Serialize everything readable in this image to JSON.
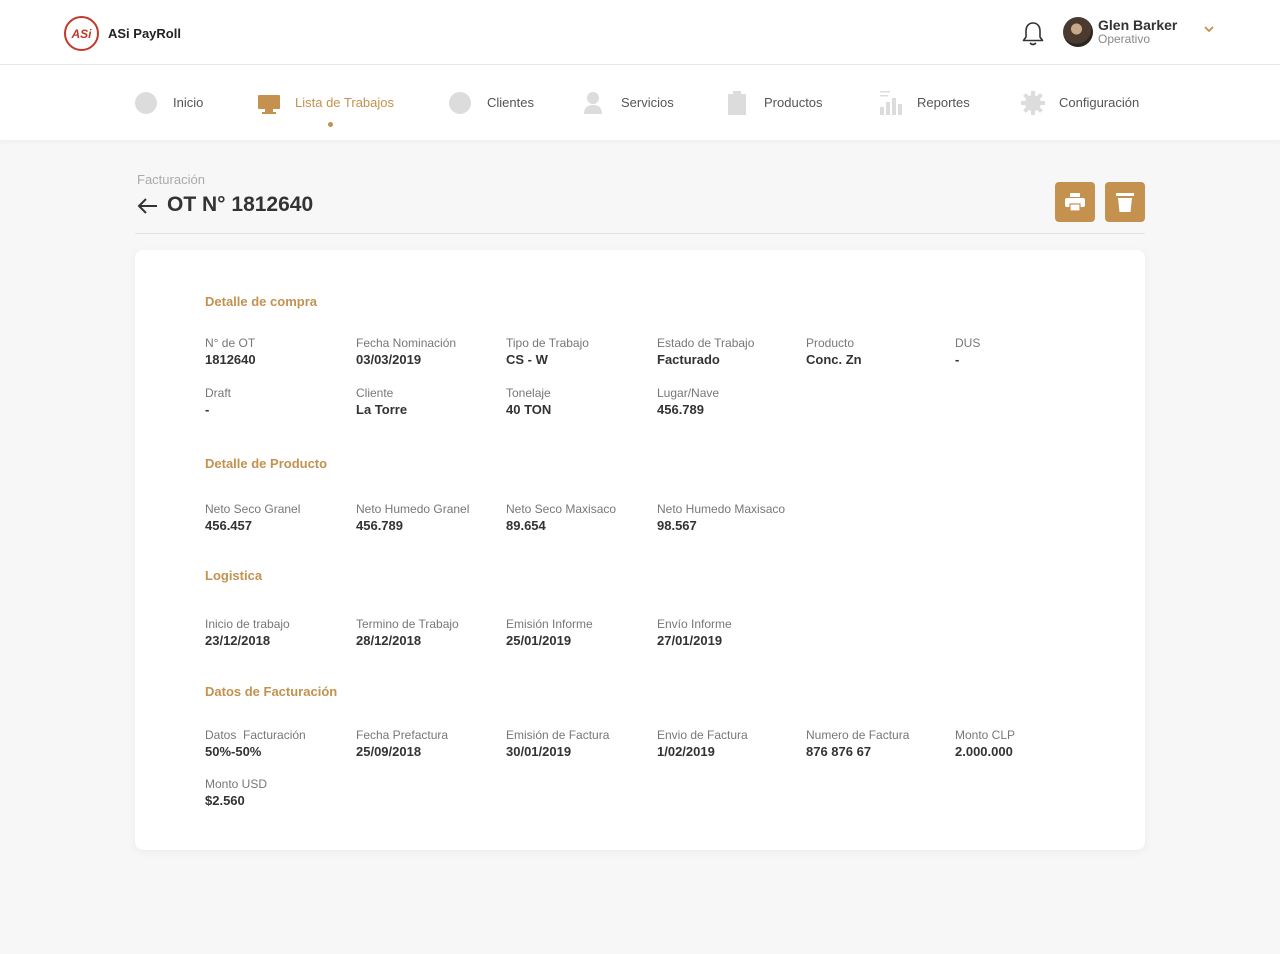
{
  "app": {
    "name": "ASi PayRoll",
    "logo_text": "ASi"
  },
  "user": {
    "name": "Glen Barker",
    "role": "Operativo"
  },
  "nav": {
    "items": [
      {
        "label": "Inicio",
        "icon": "home-icon"
      },
      {
        "label": "Lista de Trabajos",
        "icon": "monitor-icon",
        "active": true
      },
      {
        "label": "Clientes",
        "icon": "clients-icon"
      },
      {
        "label": "Servicios",
        "icon": "user-icon"
      },
      {
        "label": "Productos",
        "icon": "clipboard-icon"
      },
      {
        "label": "Reportes",
        "icon": "chart-icon"
      },
      {
        "label": "Configuración",
        "icon": "gear-icon"
      }
    ]
  },
  "colors": {
    "accent": "#c4914f",
    "logo": "#c0392b"
  },
  "header": {
    "breadcrumb": "Facturación",
    "title": "OT N° 1812640"
  },
  "sections": {
    "compra": {
      "title": "Detalle de compra",
      "fields": [
        {
          "label": "N° de OT",
          "value": "1812640"
        },
        {
          "label": "Fecha Nominación",
          "value": "03/03/2019"
        },
        {
          "label": "Tipo de Trabajo",
          "value": "CS - W"
        },
        {
          "label": "Estado de Trabajo",
          "value": "Facturado"
        },
        {
          "label": "Producto",
          "value": "Conc. Zn"
        },
        {
          "label": "DUS",
          "value": "-"
        },
        {
          "label": "Draft",
          "value": "-"
        },
        {
          "label": "Cliente",
          "value": "La Torre"
        },
        {
          "label": "Tonelaje",
          "value": "40 TON"
        },
        {
          "label": "Lugar/Nave",
          "value": "456.789"
        }
      ]
    },
    "producto": {
      "title": "Detalle de Producto",
      "fields": [
        {
          "label": "Neto Seco Granel",
          "value": "456.457"
        },
        {
          "label": "Neto Humedo Granel",
          "value": "456.789"
        },
        {
          "label": "Neto Seco Maxisaco",
          "value": "89.654"
        },
        {
          "label": "Neto Humedo Maxisaco",
          "value": "98.567"
        }
      ]
    },
    "logistica": {
      "title": "Logistica",
      "fields": [
        {
          "label": "Inicio de trabajo",
          "value": "23/12/2018"
        },
        {
          "label": "Termino de Trabajo",
          "value": "28/12/2018"
        },
        {
          "label": "Emisión Informe",
          "value": "25/01/2019"
        },
        {
          "label": "Envío Informe",
          "value": "27/01/2019"
        }
      ]
    },
    "facturacion": {
      "title": "Datos de Facturación",
      "fields": [
        {
          "label": "Datos  Facturación",
          "value": "50%-50%"
        },
        {
          "label": "Fecha Prefactura",
          "value": "25/09/2018"
        },
        {
          "label": "Emisión de Factura",
          "value": "30/01/2019"
        },
        {
          "label": "Envio de Factura",
          "value": "1/02/2019"
        },
        {
          "label": "Numero de Factura",
          "value": "876 876 67"
        },
        {
          "label": "Monto CLP",
          "value": "2.000.000"
        },
        {
          "label": "Monto USD",
          "value": "$2.560"
        }
      ]
    }
  }
}
